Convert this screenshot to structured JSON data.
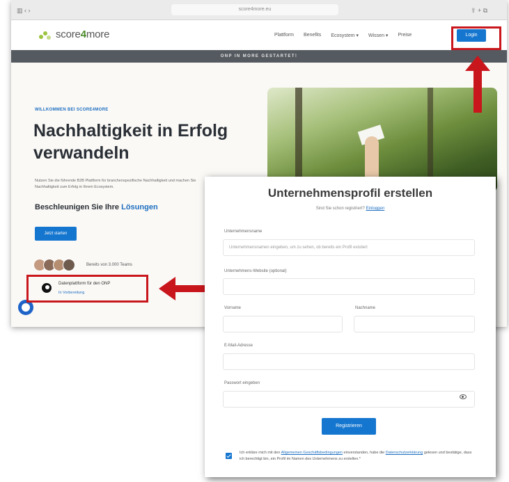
{
  "browser": {
    "url": "score4more.eu"
  },
  "nav": {
    "logo_prefix": "score",
    "logo_number": "4",
    "logo_suffix": "more",
    "links": [
      "Plattform",
      "Benefits",
      "Ecosystem ▾",
      "Wissen ▾",
      "Preise"
    ],
    "login_label": "Login"
  },
  "banner": {
    "text": "ONP IN MORE GESTARTET!"
  },
  "hero": {
    "welcome": "WILLKOMMEN BEI SCORE4MORE",
    "title": "Nachhaltigkeit in Erfolg verwandeln",
    "text": "Nutzen Sie die führende B2B Plattform für branchenspezifische Nachhaltigkeit und machen Sie Nachhaltigkeit zum Erfolg in Ihrem Ecosystem.",
    "accelerate_prefix": "Beschleunigen Sie Ihre",
    "accelerate_highlight": "Lösungen",
    "cta_label": "Jetzt starten",
    "avatars_text": "Bereits von 3.000 Teams",
    "sdg_title": "Datenplattform für den ONP",
    "sdg_sub": "In Vorbereitung"
  },
  "form": {
    "title": "Unternehmensprofil erstellen",
    "already_text": "Sind Sie schon registriert?",
    "already_link": "Einloggen",
    "company_label": "Unternehmensname",
    "company_placeholder": "Unternehmensnamen eingeben, um zu sehen, ob bereits ein Profil existiert",
    "website_label": "Unternehmens-Website (optional)",
    "firstname_label": "Vorname",
    "lastname_label": "Nachname",
    "email_label": "E-Mail-Adresse",
    "password_label": "Passwort eingeben",
    "register_label": "Registrieren",
    "terms_1": "Ich erkläre mich mit den",
    "terms_link1": "Allgemeinen Geschäftsbedingungen",
    "terms_2": "einverstanden, habe die",
    "terms_link2": "Datenschutzerklärung",
    "terms_3": "gelesen und bestätige, dass ich berechtigt bin, ein Profil im Namen des Unternehmens zu erstellen.*"
  },
  "colors": {
    "primary": "#1576cf",
    "annotation": "#c8161c",
    "brand_green": "#9bc43e"
  }
}
